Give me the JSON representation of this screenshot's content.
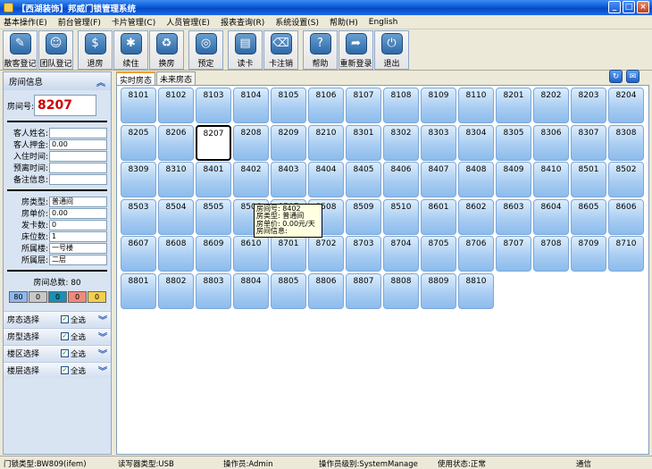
{
  "window": {
    "title": "【西湖装饰】邦威门锁管理系统",
    "buttons": [
      "_",
      "□",
      "×"
    ]
  },
  "menu": [
    "基本操作(E)",
    "前台管理(F)",
    "卡片管理(C)",
    "人员管理(E)",
    "报表查询(R)",
    "系统设置(S)",
    "帮助(H)",
    "English"
  ],
  "toolbar": [
    {
      "label": "散客登记",
      "icon": "pencil-icon",
      "glyph": "✎"
    },
    {
      "label": "团队登记",
      "icon": "group-icon",
      "glyph": "☺"
    },
    {
      "label": "退房",
      "icon": "money-bag-icon",
      "glyph": "$"
    },
    {
      "label": "续住",
      "icon": "snowflake-icon",
      "glyph": "✱"
    },
    {
      "label": "换房",
      "icon": "recycle-icon",
      "glyph": "♻"
    },
    {
      "label": "预定",
      "icon": "globe-icon",
      "glyph": "◎"
    },
    {
      "label": "读卡",
      "icon": "card-reader-icon",
      "glyph": "▤"
    },
    {
      "label": "卡注销",
      "icon": "trash-icon",
      "glyph": "⌫"
    },
    {
      "label": "帮助",
      "icon": "help-icon",
      "glyph": "?"
    },
    {
      "label": "重新登录",
      "icon": "relogin-icon",
      "glyph": "➦"
    },
    {
      "label": "退出",
      "icon": "power-icon",
      "glyph": "⏻"
    }
  ],
  "left": {
    "header": "房间信息",
    "room_label": "房间号:",
    "room_value": "8207",
    "guest_fields": [
      {
        "label": "客人姓名:",
        "value": ""
      },
      {
        "label": "客人押金:",
        "value": "0.00"
      },
      {
        "label": "入住时间:",
        "value": ""
      },
      {
        "label": "预离时间:",
        "value": ""
      },
      {
        "label": "备注信息:",
        "value": ""
      }
    ],
    "room_fields": [
      {
        "label": "房类型:",
        "value": "普通间"
      },
      {
        "label": "房单价:",
        "value": "0.00"
      },
      {
        "label": "发卡数:",
        "value": "0"
      },
      {
        "label": "床位数:",
        "value": "1"
      },
      {
        "label": "所属楼:",
        "value": "一号楼"
      },
      {
        "label": "所属层:",
        "value": "二层"
      }
    ],
    "total": "房间总数: 80",
    "badges": [
      {
        "value": "80",
        "color": "#8fb8ef"
      },
      {
        "value": "0",
        "color": "#c8c8c8"
      },
      {
        "value": "0",
        "color": "#1c8fb3"
      },
      {
        "value": "0",
        "color": "#ef8a7d"
      },
      {
        "value": "0",
        "color": "#f2d04d"
      }
    ],
    "filters": [
      {
        "label": "房态选择",
        "all": "全选"
      },
      {
        "label": "房型选择",
        "all": "全选"
      },
      {
        "label": "楼区选择",
        "all": "全选"
      },
      {
        "label": "楼层选择",
        "all": "全选"
      }
    ]
  },
  "tabs": [
    "实时房态",
    "未来房态"
  ],
  "rooms": [
    "8101",
    "8102",
    "8103",
    "8104",
    "8105",
    "8106",
    "8107",
    "8108",
    "8109",
    "8110",
    "8201",
    "8202",
    "8203",
    "8204",
    "8205",
    "8206",
    "8207",
    "8208",
    "8209",
    "8210",
    "8301",
    "8302",
    "8303",
    "8304",
    "8305",
    "8306",
    "8307",
    "8308",
    "8309",
    "8310",
    "8401",
    "8402",
    "8403",
    "8404",
    "8405",
    "8406",
    "8407",
    "8408",
    "8409",
    "8410",
    "8501",
    "8502",
    "8503",
    "8504",
    "8505",
    "8506",
    "8507",
    "8508",
    "8509",
    "8510",
    "8601",
    "8602",
    "8603",
    "8604",
    "8605",
    "8606",
    "8607",
    "8608",
    "8609",
    "8610",
    "8701",
    "8702",
    "8703",
    "8704",
    "8705",
    "8706",
    "8707",
    "8708",
    "8709",
    "8710",
    "8801",
    "8802",
    "8803",
    "8804",
    "8805",
    "8806",
    "8807",
    "8808",
    "8809",
    "8810"
  ],
  "selected_room": "8207",
  "tooltip": [
    "房间号:    8402",
    "房类型:    普通间",
    "房单价:    0.00元/天",
    "房间信息:"
  ],
  "status": {
    "lock_type": "门锁类型:BW809(ifem)",
    "reader_type": "读写器类型:USB",
    "operator": "操作员:Admin",
    "operator_level": "操作员级别:SystemManage",
    "usage": "使用状态:正常",
    "comm": "通信"
  }
}
